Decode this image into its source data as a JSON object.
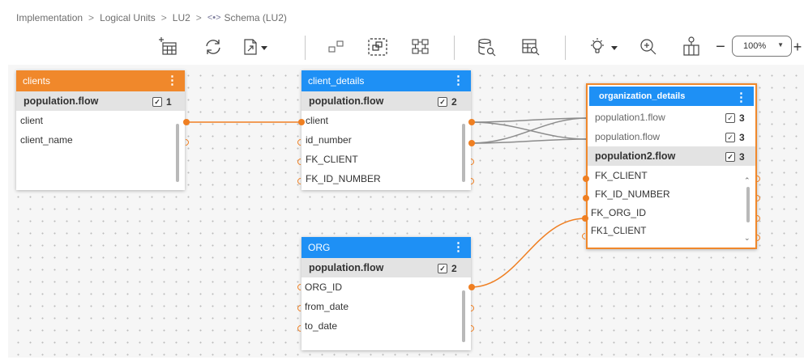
{
  "breadcrumb": {
    "items": [
      "Implementation",
      "Logical Units",
      "LU2",
      "Schema (LU2)"
    ],
    "separator": ">"
  },
  "toolbar": {
    "icons": [
      "add-table-icon",
      "refresh-icon",
      "export-icon",
      "group-icon",
      "ungroup-icon",
      "auto-layout-icon",
      "data-inspect-icon",
      "table-inspect-icon",
      "light-bulb-icon",
      "zoom-in-icon",
      "fit-to-screen-icon"
    ],
    "zoom_out_label": "−",
    "zoom_in_label": "+",
    "zoom_value": "100%"
  },
  "nodes": {
    "clients": {
      "title": "clients",
      "header_color": "#f0882b",
      "flows": [
        {
          "label": "population.flow",
          "checked": true,
          "count": "1"
        }
      ],
      "fields": [
        "client",
        "client_name"
      ]
    },
    "client_details": {
      "title": "client_details",
      "header_color": "#1e90f5",
      "flows": [
        {
          "label": "population.flow",
          "checked": true,
          "count": "2"
        }
      ],
      "fields": [
        "client",
        "id_number",
        "FK_CLIENT",
        "FK_ID_NUMBER"
      ]
    },
    "org": {
      "title": "ORG",
      "header_color": "#1e90f5",
      "flows": [
        {
          "label": "population.flow",
          "checked": true,
          "count": "2"
        }
      ],
      "fields": [
        "ORG_ID",
        "from_date",
        "to_date"
      ]
    },
    "organization_details": {
      "title": "organization_details",
      "header_color": "#1e90f5",
      "border_color": "#f0882b",
      "flows": [
        {
          "label": "population1.flow",
          "checked": true,
          "count": "3"
        },
        {
          "label": "population.flow",
          "checked": true,
          "count": "3"
        },
        {
          "label": "population2.flow",
          "checked": true,
          "count": "3"
        }
      ],
      "fields": [
        "FK_CLIENT",
        "FK_ID_NUMBER",
        "FK_ORG_ID",
        "FK1_CLIENT"
      ]
    }
  },
  "colors": {
    "link_active": "#ef7f22",
    "link_inactive": "#8c8c8c",
    "canvas_bg": "#f6f6f6"
  }
}
